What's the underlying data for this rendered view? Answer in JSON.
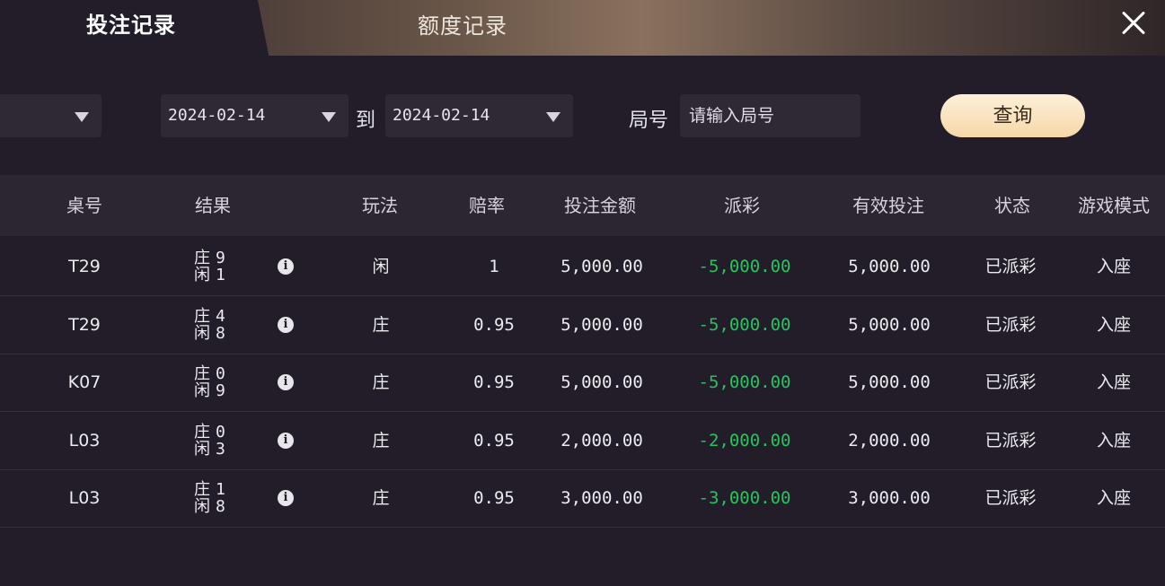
{
  "header": {
    "tabs": [
      {
        "label": "投注记录",
        "active": true
      },
      {
        "label": "额度记录",
        "active": false
      }
    ],
    "close_icon": "close-icon"
  },
  "filters": {
    "first_select_value": "",
    "date_from": "2024-02-14",
    "to_label": "到",
    "date_to": "2024-02-14",
    "round_label": "局号",
    "round_placeholder": "请输入局号",
    "query_label": "查询"
  },
  "table": {
    "headers": [
      "桌号",
      "结果",
      "玩法",
      "赔率",
      "投注金额",
      "派彩",
      "有效投注",
      "状态",
      "游戏模式"
    ],
    "rows": [
      {
        "table": "T29",
        "banker_label": "庄",
        "banker": "9",
        "player_label": "闲",
        "player": "1",
        "bet_type": "闲",
        "odds": "1",
        "amount": "5,000.00",
        "payout": "-5,000.00",
        "valid": "5,000.00",
        "status": "已派彩",
        "mode": "入座"
      },
      {
        "table": "T29",
        "banker_label": "庄",
        "banker": "4",
        "player_label": "闲",
        "player": "8",
        "bet_type": "庄",
        "odds": "0.95",
        "amount": "5,000.00",
        "payout": "-5,000.00",
        "valid": "5,000.00",
        "status": "已派彩",
        "mode": "入座"
      },
      {
        "table": "K07",
        "banker_label": "庄",
        "banker": "0",
        "player_label": "闲",
        "player": "9",
        "bet_type": "庄",
        "odds": "0.95",
        "amount": "5,000.00",
        "payout": "-5,000.00",
        "valid": "5,000.00",
        "status": "已派彩",
        "mode": "入座"
      },
      {
        "table": "L03",
        "banker_label": "庄",
        "banker": "0",
        "player_label": "闲",
        "player": "3",
        "bet_type": "庄",
        "odds": "0.95",
        "amount": "2,000.00",
        "payout": "-2,000.00",
        "valid": "2,000.00",
        "status": "已派彩",
        "mode": "入座"
      },
      {
        "table": "L03",
        "banker_label": "庄",
        "banker": "1",
        "player_label": "闲",
        "player": "8",
        "bet_type": "庄",
        "odds": "0.95",
        "amount": "3,000.00",
        "payout": "-3,000.00",
        "valid": "3,000.00",
        "status": "已派彩",
        "mode": "入座"
      }
    ]
  },
  "colors": {
    "background": "#221d29",
    "payout_negative": "#22c55e",
    "query_button": "#f6d8a8"
  }
}
